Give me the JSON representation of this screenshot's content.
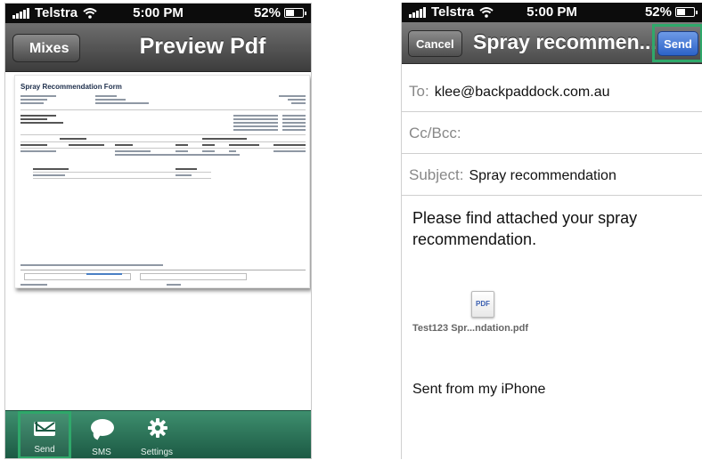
{
  "left": {
    "status": {
      "carrier": "Telstra",
      "time": "5:00 PM",
      "battery": "52%",
      "battery_level": 0.52
    },
    "nav": {
      "back_label": "Mixes",
      "title": "Preview Pdf"
    },
    "pdf": {
      "title": "Spray Recommendation Form"
    },
    "tabs": [
      {
        "label": "Send",
        "icon": "envelope-icon"
      },
      {
        "label": "SMS",
        "icon": "speech-bubble-icon"
      },
      {
        "label": "Settings",
        "icon": "gear-icon"
      }
    ],
    "colors": {
      "tabbar": "#2d7a5b",
      "highlight": "#2fa86a"
    }
  },
  "right": {
    "status": {
      "carrier": "Telstra",
      "time": "5:00 PM",
      "battery": "52%",
      "battery_level": 0.52
    },
    "nav": {
      "cancel_label": "Cancel",
      "title": "Spray recommen...",
      "send_label": "Send"
    },
    "fields": {
      "to_label": "To:",
      "to_value": "klee@backpaddock.com.au",
      "cc_label": "Cc/Bcc:",
      "subject_label": "Subject:",
      "subject_value": "Spray recommendation"
    },
    "body": "Please find attached your spray recommendation.",
    "attachment": {
      "icon_text": "PDF",
      "name": "Test123 Spr...ndation.pdf"
    },
    "signature": "Sent from my iPhone",
    "colors": {
      "send_button": "#3a6fd0",
      "highlight": "#2fa86a"
    }
  }
}
